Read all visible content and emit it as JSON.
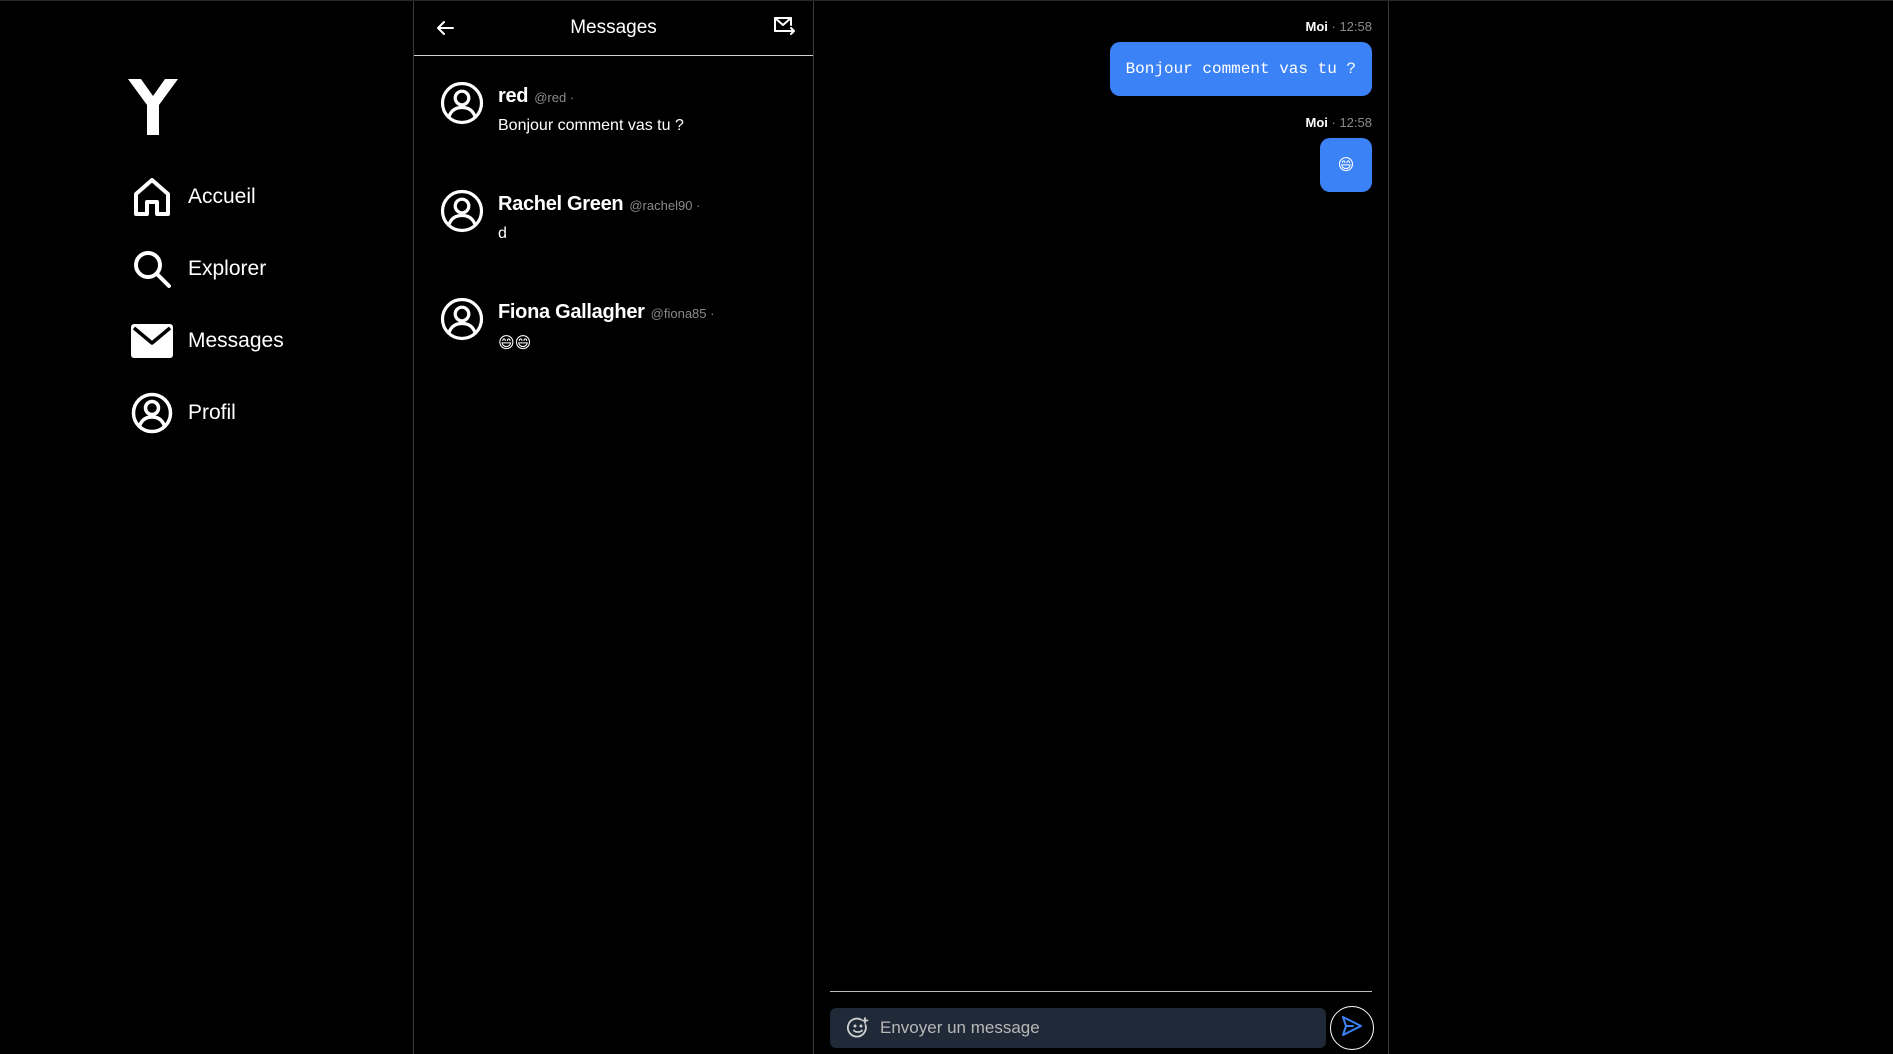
{
  "nav": {
    "items": [
      {
        "label": "Accueil",
        "icon": "home-icon"
      },
      {
        "label": "Explorer",
        "icon": "search-icon"
      },
      {
        "label": "Messages",
        "icon": "mail-icon"
      },
      {
        "label": "Profil",
        "icon": "user-icon"
      }
    ]
  },
  "conversations": {
    "title": "Messages",
    "items": [
      {
        "name": "red",
        "handle": "@red ·",
        "preview": "Bonjour comment vas tu ?"
      },
      {
        "name": "Rachel Green",
        "handle": "@rachel90 ·",
        "preview": "d"
      },
      {
        "name": "Fiona Gallagher",
        "handle": "@fiona85 ·",
        "preview": "😄😄"
      }
    ]
  },
  "chat": {
    "messages": [
      {
        "author": "Moi",
        "time": "· 12:58",
        "text": "Bonjour comment vas tu ?"
      },
      {
        "author": "Moi",
        "time": "· 12:58",
        "text": "😄"
      }
    ],
    "composer": {
      "placeholder": "Envoyer un message"
    }
  },
  "colors": {
    "background": "#000000",
    "accent": "#3b82f6",
    "input_bg": "#1f2937"
  }
}
